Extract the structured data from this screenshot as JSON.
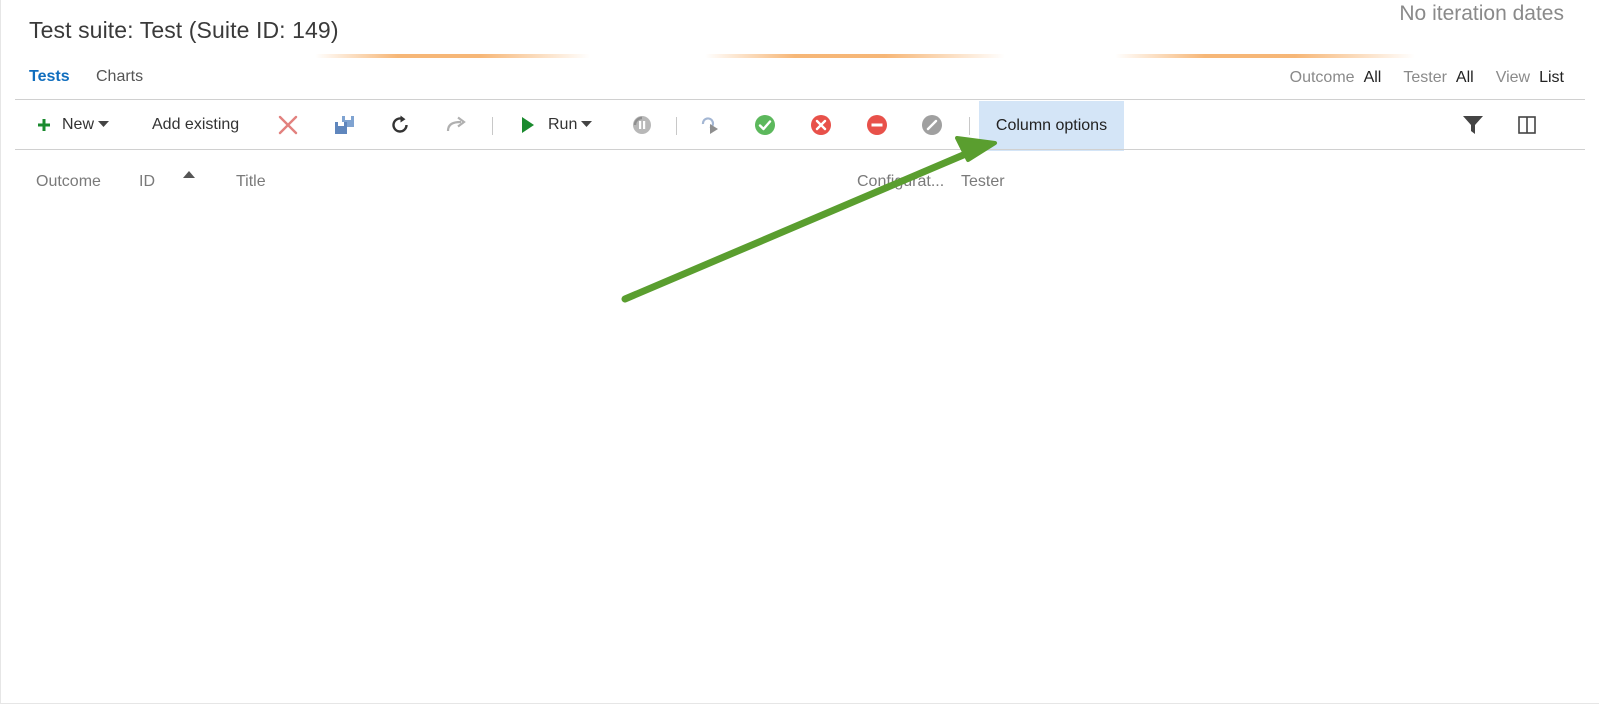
{
  "header": {
    "title": "Test suite: Test (Suite ID: 149)",
    "iteration": "No iteration dates"
  },
  "tabs": [
    {
      "label": "Tests",
      "active": true
    },
    {
      "label": "Charts",
      "active": false
    }
  ],
  "filters": [
    {
      "label": "Outcome",
      "value": "All"
    },
    {
      "label": "Tester",
      "value": "All"
    },
    {
      "label": "View",
      "value": "List"
    }
  ],
  "toolbar": {
    "new_label": "New",
    "add_existing_label": "Add existing",
    "run_label": "Run",
    "column_options_label": "Column options",
    "icons": [
      "plus-icon",
      "caret-down-icon",
      "delete-icon",
      "save-icon",
      "refresh-icon",
      "redo-icon",
      "play-icon",
      "caret-down-icon",
      "pause-icon",
      "resume-icon",
      "pass-icon",
      "fail-icon",
      "block-icon",
      "not-applicable-icon",
      "filter-icon",
      "pane-icon"
    ]
  },
  "grid": {
    "columns": [
      "Outcome",
      "ID",
      "Title",
      "Configurat...",
      "Tester"
    ],
    "sort_column": "ID",
    "sort_direction": "ascending"
  },
  "colors": {
    "accent": "#106ebe",
    "highlight": "#d4e5f7",
    "annotation_arrow": "#5a9e2f",
    "pass": "#5cb85c",
    "fail": "#e8514a"
  }
}
